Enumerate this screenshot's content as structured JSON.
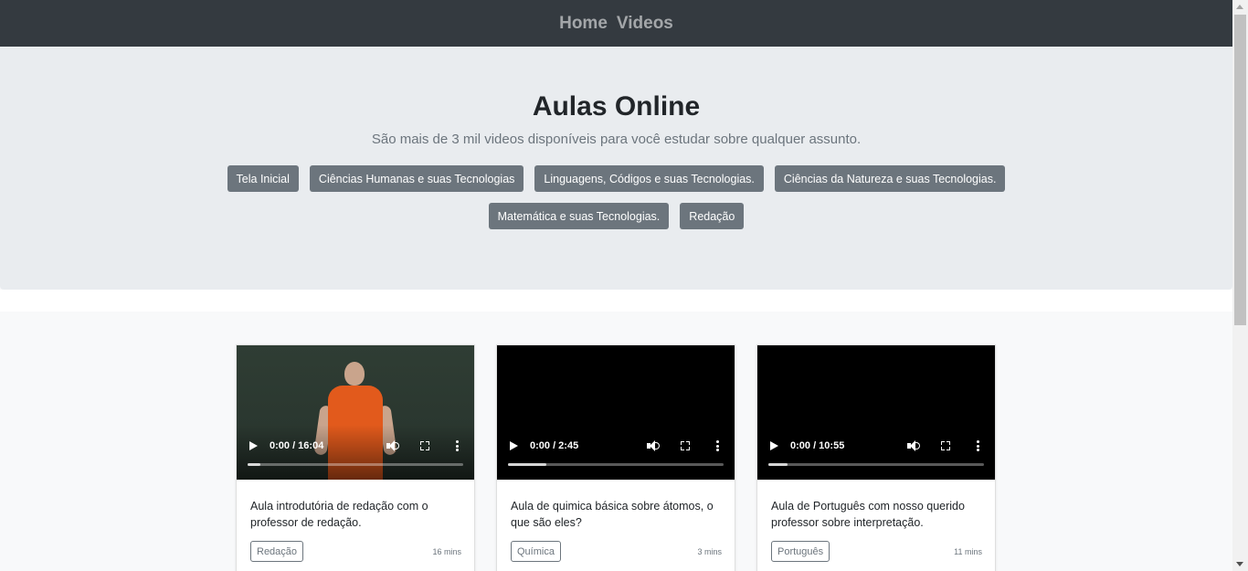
{
  "nav": {
    "home": "Home",
    "videos": "Videos"
  },
  "hero": {
    "title": "Aulas Online",
    "lead": "São mais de 3 mil videos disponíveis para você estudar sobre qualquer assunto.",
    "categories_row1": [
      "Tela Inicial",
      "Ciências Humanas e suas Tecnologias",
      "Linguagens, Códigos e suas Tecnologias.",
      "Ciências da Natureza e suas Tecnologias."
    ],
    "categories_row2": [
      "Matemática e suas Tecnologias.",
      "Redação"
    ]
  },
  "cards": [
    {
      "time": "0:00 / 16:04",
      "progress": 0.06,
      "description": "Aula introdutória de redação com o professor de redação.",
      "tag": "Redação",
      "duration": "16 mins"
    },
    {
      "time": "0:00 / 2:45",
      "progress": 0.18,
      "description": "Aula de quimica básica sobre átomos, o que são eles?",
      "tag": "Química",
      "duration": "3 mins"
    },
    {
      "time": "0:00 / 10:55",
      "progress": 0.09,
      "description": "Aula de Português com nosso querido professor sobre interpretação.",
      "tag": "Português",
      "duration": "11 mins"
    }
  ],
  "colors": {
    "navbar": "#343a40",
    "jumbotron": "#e9ecef",
    "button": "#6c757d"
  },
  "icons": [
    "play-icon",
    "volume-icon",
    "fullscreen-icon",
    "more-options-icon"
  ]
}
